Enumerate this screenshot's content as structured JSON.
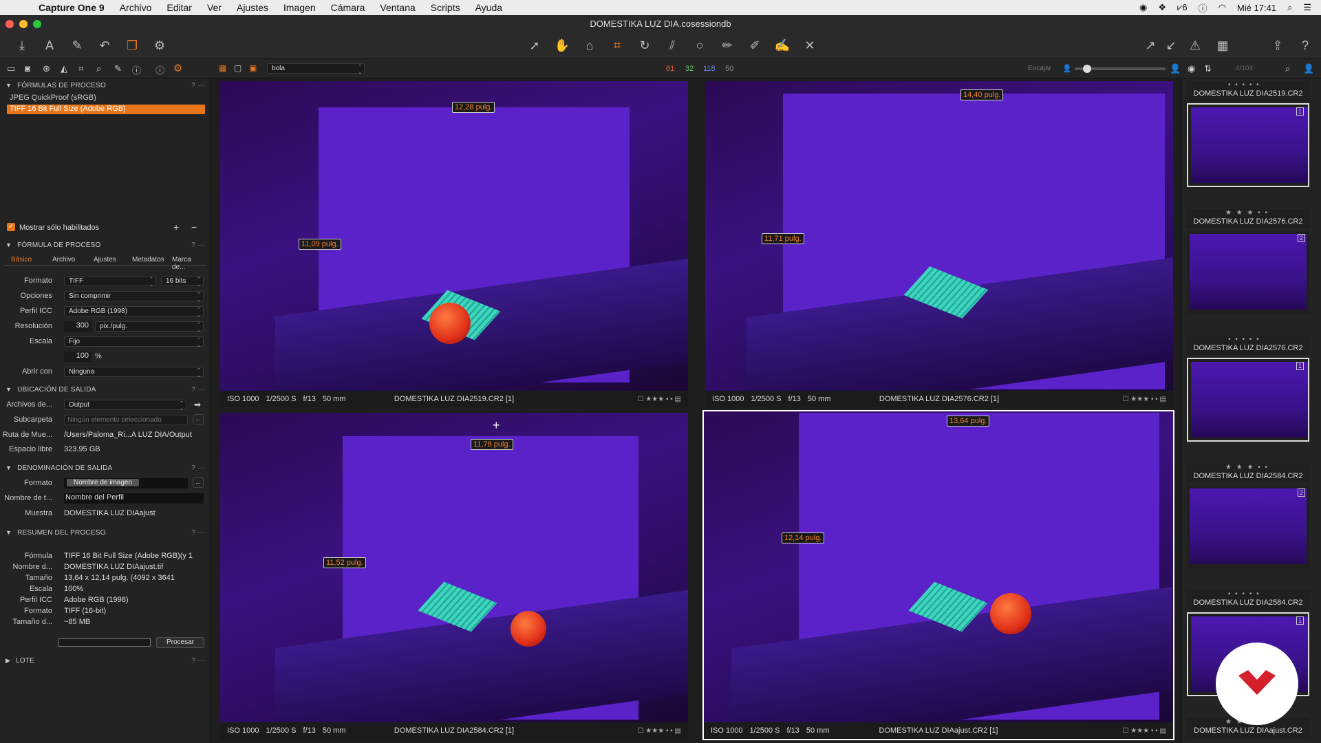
{
  "menubar": {
    "app": "Capture One 9",
    "items": [
      "Archivo",
      "Editar",
      "Ver",
      "Ajustes",
      "Imagen",
      "Cámara",
      "Ventana",
      "Scripts",
      "Ayuda"
    ],
    "clock": "Mié 17:41",
    "adobe_count": "6"
  },
  "window": {
    "title": "DOMESTIKA LUZ DIA.cosessiondb"
  },
  "subbar": {
    "search_value": "bola",
    "count_red": "61",
    "count_green": "32",
    "count_blue": "118",
    "count_gray": "50",
    "zoom_label": "Encajar",
    "page_counter": "4/104"
  },
  "left": {
    "recipes_header": "FÓRMULAS DE PROCESO",
    "recipes": [
      "JPEG QuickProof (sRGB)",
      "TIFF 16 Bit Full Size (Adobe RGB)"
    ],
    "show_enabled": "Mostrar sólo habilitados",
    "recipe_header": "FÓRMULA DE PROCESO",
    "tabs": [
      "Básico",
      "Archivo",
      "Ajustes",
      "Metadatos",
      "Marca de..."
    ],
    "formato_lbl": "Formato",
    "formato": "TIFF",
    "bits": "16 bits",
    "opciones_lbl": "Opciones",
    "opciones": "Sin comprimir",
    "icc_lbl": "Perfil ICC",
    "icc": "Adobe RGB (1998)",
    "res_lbl": "Resolución",
    "res": "300",
    "res_unit": "pix./pulg.",
    "escala_lbl": "Escala",
    "escala": "Fijo",
    "escala_pct": "100",
    "pct": "%",
    "abrir_lbl": "Abrir con",
    "abrir": "Ninguna",
    "out_header": "UBICACIÓN DE SALIDA",
    "archivos_lbl": "Archivos de...",
    "archivos": "Output",
    "sub_lbl": "Subcarpeta",
    "sub_ph": "Ningún elemento seleccionado",
    "ruta_lbl": "Ruta de Mue...",
    "ruta": "/Users/Paloma_Ri...A LUZ DIA/Output",
    "esp_lbl": "Espacio libre",
    "esp": "323.95 GB",
    "name_header": "DENOMINACIÓN DE SALIDA",
    "nf_lbl": "Formato",
    "nf": "Nombre de imagen",
    "nt_lbl": "Nombre de t...",
    "nt": "Nombre del Perfil",
    "muestra_lbl": "Muestra",
    "muestra": "DOMESTIKA LUZ DIAajust",
    "sum_header": "RESUMEN DEL PROCESO",
    "summary": [
      [
        "Fórmula",
        "TIFF 16 Bit Full Size (Adobe RGB)(y 1"
      ],
      [
        "Nombre d...",
        "DOMESTIKA LUZ DIAajust.tif"
      ],
      [
        "Tamaño",
        "13,64 x 12,14 pulg. (4092 x 3641"
      ],
      [
        "Escala",
        "100%"
      ],
      [
        "Perfil ICC",
        "Adobe RGB (1998)"
      ],
      [
        "Formato",
        "TIFF (16-bit)"
      ],
      [
        "Tamaño d...",
        "~85 MB"
      ]
    ],
    "process_btn": "Procesar",
    "lote_header": "LOTE"
  },
  "viewer": [
    {
      "iso": "ISO 1000",
      "shutter": "1/2500 S",
      "aperture": "f/13",
      "focal": "50 mm",
      "file": "DOMESTIKA LUZ DIA2519.CR2 [1]",
      "w": "12,28 pulg.",
      "h": "11,09 pulg."
    },
    {
      "iso": "ISO 1000",
      "shutter": "1/2500 S",
      "aperture": "f/13",
      "focal": "50 mm",
      "file": "DOMESTIKA LUZ DIA2576.CR2 [1]",
      "w": "14,40 pulg.",
      "h": "11,71 pulg."
    },
    {
      "iso": "ISO 1000",
      "shutter": "1/2500 S",
      "aperture": "f/13",
      "focal": "50 mm",
      "file": "DOMESTIKA LUZ DIA2584.CR2 [1]",
      "w": "11,78 pulg.",
      "h": "11,52 pulg."
    },
    {
      "iso": "ISO 1000",
      "shutter": "1/2500 S",
      "aperture": "f/13",
      "focal": "50 mm",
      "file": "DOMESTIKA LUZ DIAajust.CR2 [1]",
      "w": "13,64 pulg.",
      "h": "12,14 pulg."
    }
  ],
  "browser": {
    "captions": [
      "DOMESTIKA LUZ DIA2519.CR2",
      "DOMESTIKA LUZ DIA2576.CR2",
      "DOMESTIKA LUZ DIA2576.CR2",
      "DOMESTIKA LUZ DIA2584.CR2",
      "DOMESTIKA LUZ DIA2584.CR2",
      "DOMESTIKA LUZ DIAajust.CR2"
    ],
    "badges": [
      "1",
      "2",
      "1",
      "2",
      "1"
    ]
  },
  "colors": {
    "accent": "#e8771c",
    "photo_bg": "#5a22c8",
    "measure_text": "#f08030"
  }
}
